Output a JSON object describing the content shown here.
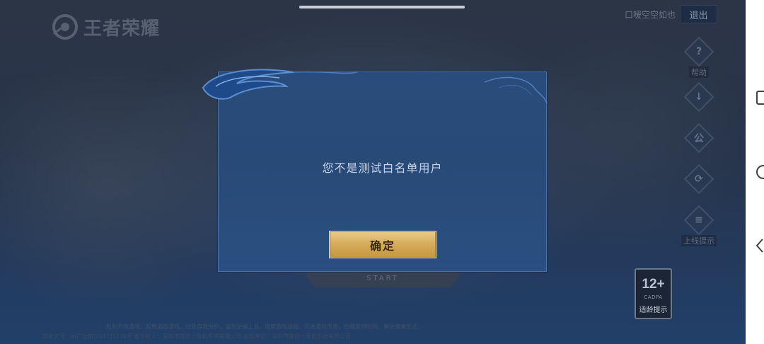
{
  "game": {
    "logo_text": "王者荣耀",
    "user_name": "口嗳空空如也",
    "logout_label": "退出",
    "side_menu": [
      {
        "icon": "help-icon",
        "glyph": "?",
        "label": "帮助"
      },
      {
        "icon": "download-icon",
        "glyph": "↓",
        "label": ""
      },
      {
        "icon": "announcement-icon",
        "glyph": "公",
        "label": ""
      },
      {
        "icon": "repair-icon",
        "glyph": "⟳",
        "label": ""
      },
      {
        "icon": "notice-icon",
        "glyph": "≡",
        "label": "上线提示"
      }
    ],
    "start_label": "START",
    "age_rating": {
      "number": "12+",
      "org": "CADPA",
      "tip": "适龄提示"
    },
    "footer_line1": "抵制不良游戏，拒绝盗版游戏。注意自我保护，谨防受骗上当。适度游戏益脑，沉迷游戏伤身。合理安排时间，享受健康生活。",
    "footer_line2": "审批文号：新广出审[2015]1238号 著作权人：深圳市腾讯计算机系统有限公司 出版单位：深圳市腾讯计算机系统有限公司"
  },
  "dialog": {
    "message": "您不是测试白名单用户",
    "confirm_label": "确定"
  },
  "colors": {
    "dialog_bg": "#2a4c7c",
    "confirm_gold": "#d6ad5e"
  }
}
